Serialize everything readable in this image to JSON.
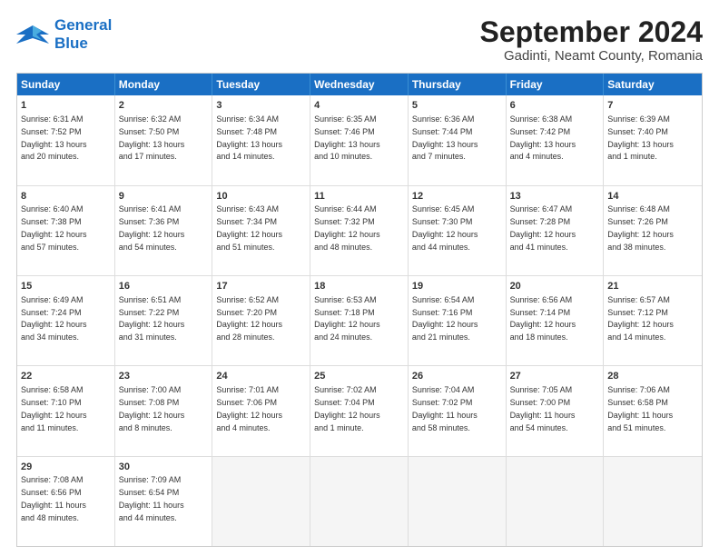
{
  "header": {
    "logo_line1": "General",
    "logo_line2": "Blue",
    "title": "September 2024",
    "subtitle": "Gadinti, Neamt County, Romania"
  },
  "weekdays": [
    "Sunday",
    "Monday",
    "Tuesday",
    "Wednesday",
    "Thursday",
    "Friday",
    "Saturday"
  ],
  "rows": [
    [
      {
        "day": "1",
        "info": "Sunrise: 6:31 AM\nSunset: 7:52 PM\nDaylight: 13 hours\nand 20 minutes."
      },
      {
        "day": "2",
        "info": "Sunrise: 6:32 AM\nSunset: 7:50 PM\nDaylight: 13 hours\nand 17 minutes."
      },
      {
        "day": "3",
        "info": "Sunrise: 6:34 AM\nSunset: 7:48 PM\nDaylight: 13 hours\nand 14 minutes."
      },
      {
        "day": "4",
        "info": "Sunrise: 6:35 AM\nSunset: 7:46 PM\nDaylight: 13 hours\nand 10 minutes."
      },
      {
        "day": "5",
        "info": "Sunrise: 6:36 AM\nSunset: 7:44 PM\nDaylight: 13 hours\nand 7 minutes."
      },
      {
        "day": "6",
        "info": "Sunrise: 6:38 AM\nSunset: 7:42 PM\nDaylight: 13 hours\nand 4 minutes."
      },
      {
        "day": "7",
        "info": "Sunrise: 6:39 AM\nSunset: 7:40 PM\nDaylight: 13 hours\nand 1 minute."
      }
    ],
    [
      {
        "day": "8",
        "info": "Sunrise: 6:40 AM\nSunset: 7:38 PM\nDaylight: 12 hours\nand 57 minutes."
      },
      {
        "day": "9",
        "info": "Sunrise: 6:41 AM\nSunset: 7:36 PM\nDaylight: 12 hours\nand 54 minutes."
      },
      {
        "day": "10",
        "info": "Sunrise: 6:43 AM\nSunset: 7:34 PM\nDaylight: 12 hours\nand 51 minutes."
      },
      {
        "day": "11",
        "info": "Sunrise: 6:44 AM\nSunset: 7:32 PM\nDaylight: 12 hours\nand 48 minutes."
      },
      {
        "day": "12",
        "info": "Sunrise: 6:45 AM\nSunset: 7:30 PM\nDaylight: 12 hours\nand 44 minutes."
      },
      {
        "day": "13",
        "info": "Sunrise: 6:47 AM\nSunset: 7:28 PM\nDaylight: 12 hours\nand 41 minutes."
      },
      {
        "day": "14",
        "info": "Sunrise: 6:48 AM\nSunset: 7:26 PM\nDaylight: 12 hours\nand 38 minutes."
      }
    ],
    [
      {
        "day": "15",
        "info": "Sunrise: 6:49 AM\nSunset: 7:24 PM\nDaylight: 12 hours\nand 34 minutes."
      },
      {
        "day": "16",
        "info": "Sunrise: 6:51 AM\nSunset: 7:22 PM\nDaylight: 12 hours\nand 31 minutes."
      },
      {
        "day": "17",
        "info": "Sunrise: 6:52 AM\nSunset: 7:20 PM\nDaylight: 12 hours\nand 28 minutes."
      },
      {
        "day": "18",
        "info": "Sunrise: 6:53 AM\nSunset: 7:18 PM\nDaylight: 12 hours\nand 24 minutes."
      },
      {
        "day": "19",
        "info": "Sunrise: 6:54 AM\nSunset: 7:16 PM\nDaylight: 12 hours\nand 21 minutes."
      },
      {
        "day": "20",
        "info": "Sunrise: 6:56 AM\nSunset: 7:14 PM\nDaylight: 12 hours\nand 18 minutes."
      },
      {
        "day": "21",
        "info": "Sunrise: 6:57 AM\nSunset: 7:12 PM\nDaylight: 12 hours\nand 14 minutes."
      }
    ],
    [
      {
        "day": "22",
        "info": "Sunrise: 6:58 AM\nSunset: 7:10 PM\nDaylight: 12 hours\nand 11 minutes."
      },
      {
        "day": "23",
        "info": "Sunrise: 7:00 AM\nSunset: 7:08 PM\nDaylight: 12 hours\nand 8 minutes."
      },
      {
        "day": "24",
        "info": "Sunrise: 7:01 AM\nSunset: 7:06 PM\nDaylight: 12 hours\nand 4 minutes."
      },
      {
        "day": "25",
        "info": "Sunrise: 7:02 AM\nSunset: 7:04 PM\nDaylight: 12 hours\nand 1 minute."
      },
      {
        "day": "26",
        "info": "Sunrise: 7:04 AM\nSunset: 7:02 PM\nDaylight: 11 hours\nand 58 minutes."
      },
      {
        "day": "27",
        "info": "Sunrise: 7:05 AM\nSunset: 7:00 PM\nDaylight: 11 hours\nand 54 minutes."
      },
      {
        "day": "28",
        "info": "Sunrise: 7:06 AM\nSunset: 6:58 PM\nDaylight: 11 hours\nand 51 minutes."
      }
    ],
    [
      {
        "day": "29",
        "info": "Sunrise: 7:08 AM\nSunset: 6:56 PM\nDaylight: 11 hours\nand 48 minutes."
      },
      {
        "day": "30",
        "info": "Sunrise: 7:09 AM\nSunset: 6:54 PM\nDaylight: 11 hours\nand 44 minutes."
      },
      {
        "day": "",
        "info": ""
      },
      {
        "day": "",
        "info": ""
      },
      {
        "day": "",
        "info": ""
      },
      {
        "day": "",
        "info": ""
      },
      {
        "day": "",
        "info": ""
      }
    ]
  ]
}
